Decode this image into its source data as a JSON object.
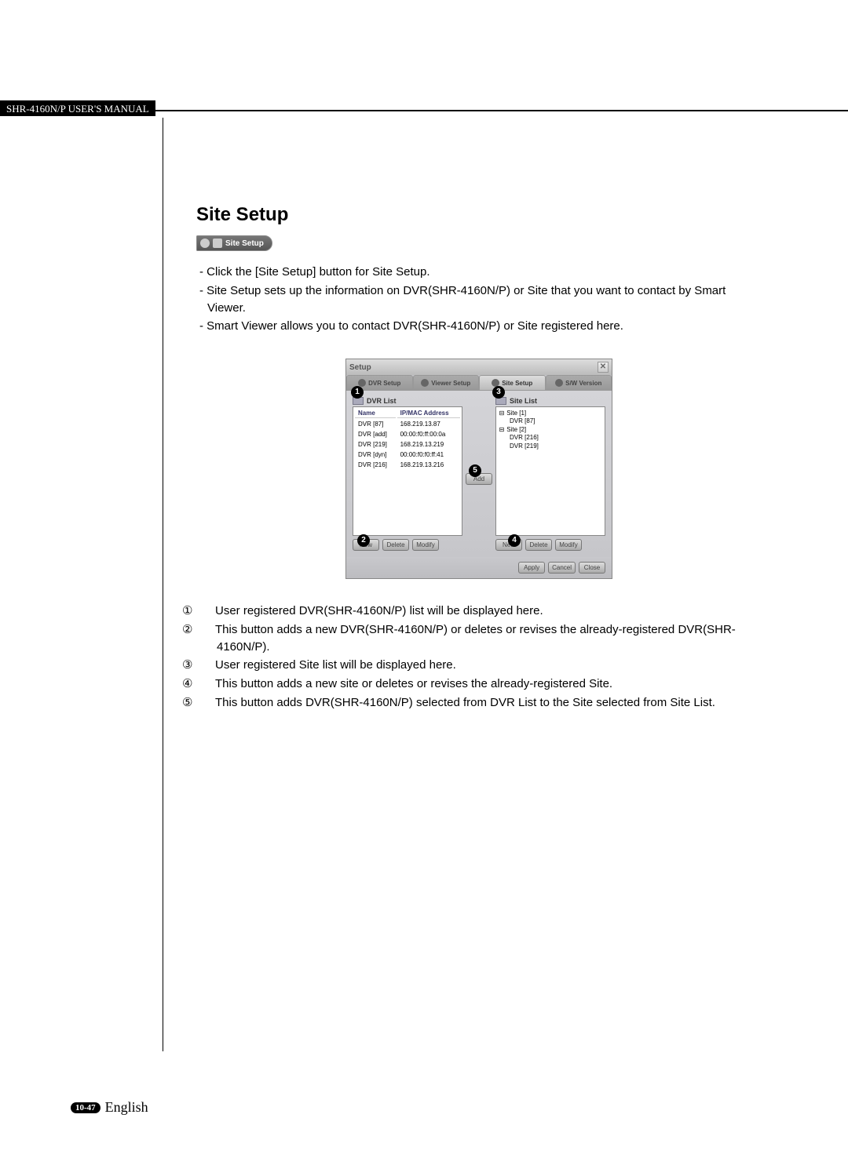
{
  "header": {
    "manual_title": "SHR-4160N/P USER'S MANUAL"
  },
  "section": {
    "title": "Site Setup"
  },
  "badge": {
    "label": "Site Setup"
  },
  "intro": {
    "b1": "- Click the [Site Setup] button for Site Setup.",
    "b2": "- Site Setup sets up the information on DVR(SHR-4160N/P) or Site that you want to contact by Smart Viewer.",
    "b3": "- Smart Viewer allows you to contact DVR(SHR-4160N/P) or Site registered here."
  },
  "shot": {
    "title": "Setup",
    "tabs": {
      "dvr": "DVR Setup",
      "viewer": "Viewer Setup",
      "site": "Site Setup",
      "sw": "S/W Version"
    },
    "dvr_panel": {
      "title": "DVR List",
      "col_name": "Name",
      "col_ip": "IP/MAC Address",
      "rows": [
        {
          "name": "DVR [87]",
          "ip": "168.219.13.87"
        },
        {
          "name": "DVR [add]",
          "ip": "00:00:f0:ff:00:0a"
        },
        {
          "name": "DVR [219]",
          "ip": "168.219.13.219"
        },
        {
          "name": "DVR [dyn]",
          "ip": "00:00:f0:f0:ff:41"
        },
        {
          "name": "DVR [216]",
          "ip": "168.219.13.216"
        }
      ],
      "btn_new": "New",
      "btn_delete": "Delete",
      "btn_modify": "Modify"
    },
    "site_panel": {
      "title": "Site List",
      "tree": {
        "s1": "Site [1]",
        "s1a": "DVR [87]",
        "s2": "Site [2]",
        "s2a": "DVR [216]",
        "s2b": "DVR [219]"
      },
      "btn_new": "New",
      "btn_delete": "Delete",
      "btn_modify": "Modify"
    },
    "add_btn": "Add",
    "footer": {
      "apply": "Apply",
      "cancel": "Cancel",
      "close": "Close"
    }
  },
  "notes": {
    "n1": "User registered DVR(SHR-4160N/P) list will be displayed here.",
    "n2": "This button adds a new DVR(SHR-4160N/P) or deletes or revises the already-registered DVR(SHR-4160N/P).",
    "n3": "User registered Site list will be displayed here.",
    "n4": "This button adds a new site or deletes or revises the already-registered Site.",
    "n5": "This button adds DVR(SHR-4160N/P) selected from DVR List to the Site selected from Site List."
  },
  "circled": {
    "c1": "①",
    "c2": "②",
    "c3": "③",
    "c4": "④",
    "c5": "⑤"
  },
  "footer": {
    "page": "10-47",
    "lang": "English"
  }
}
